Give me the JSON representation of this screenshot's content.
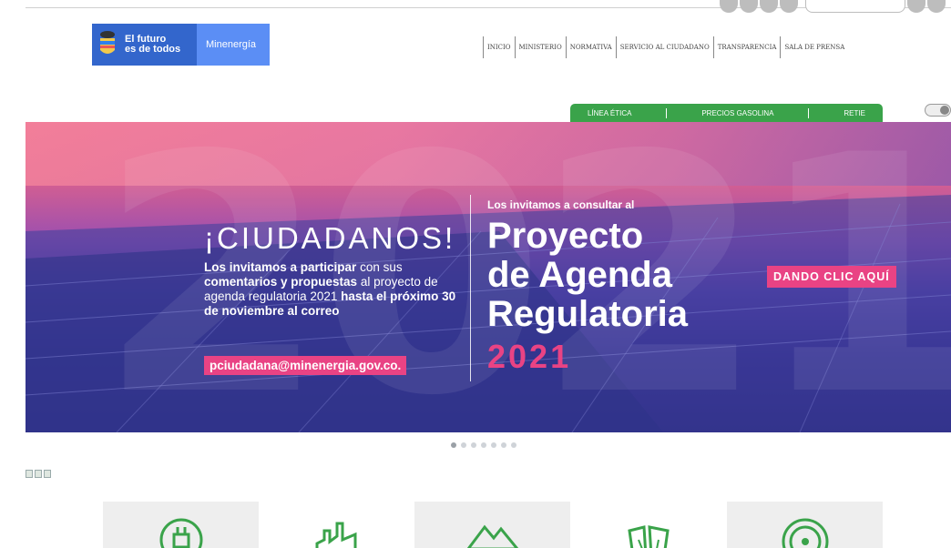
{
  "brand": {
    "tagline_line1": "El futuro",
    "tagline_line2": "es de todos",
    "ministry": "Minenergía",
    "colors": {
      "brand_blue": "#3366cc",
      "brand_light": "#5b8ef5"
    }
  },
  "mainnav": {
    "items": [
      {
        "label": "INICIO"
      },
      {
        "label": "MINISTERIO"
      },
      {
        "label": "NORMATIVA"
      },
      {
        "label": "SERVICIO AL CIUDADANO"
      },
      {
        "label": "TRANSPARENCIA"
      },
      {
        "label": "SALA DE PRENSA"
      }
    ]
  },
  "greennav": {
    "items": [
      {
        "label": "LÍNEA ÉTICA"
      },
      {
        "label": "PRECIOS GASOLINA"
      },
      {
        "label": "RETIE"
      }
    ],
    "color": "#3aa34a"
  },
  "banner": {
    "year_watermark": "2021",
    "headline": "¡CIUDADANOS!",
    "para_b1": "Los invitamos a participar",
    "para_t1": " con sus ",
    "para_b2": "comentarios y propuestas",
    "para_t2": " al proyecto de agenda regulatoria 2021 ",
    "para_b3": "hasta el próximo 30 de noviembre al correo",
    "email": "pciudadana@minenergia.gov.co.",
    "invite": "Los invitamos a consultar al",
    "project_line1": "Proyecto",
    "project_line2": "de Agenda",
    "project_line3": "Regulatoria",
    "year": "2021",
    "cta": "DANDO CLIC AQUÍ",
    "accent": "#e94384"
  },
  "carousel": {
    "slide_count": 7,
    "active_index": 0
  },
  "tiles": [
    {
      "icon": "electric-plug-icon"
    },
    {
      "icon": "industry-plant-icon"
    },
    {
      "icon": "mining-mountain-icon"
    },
    {
      "icon": "environment-leaves-icon"
    },
    {
      "icon": "nuclear-radiation-icon"
    }
  ]
}
